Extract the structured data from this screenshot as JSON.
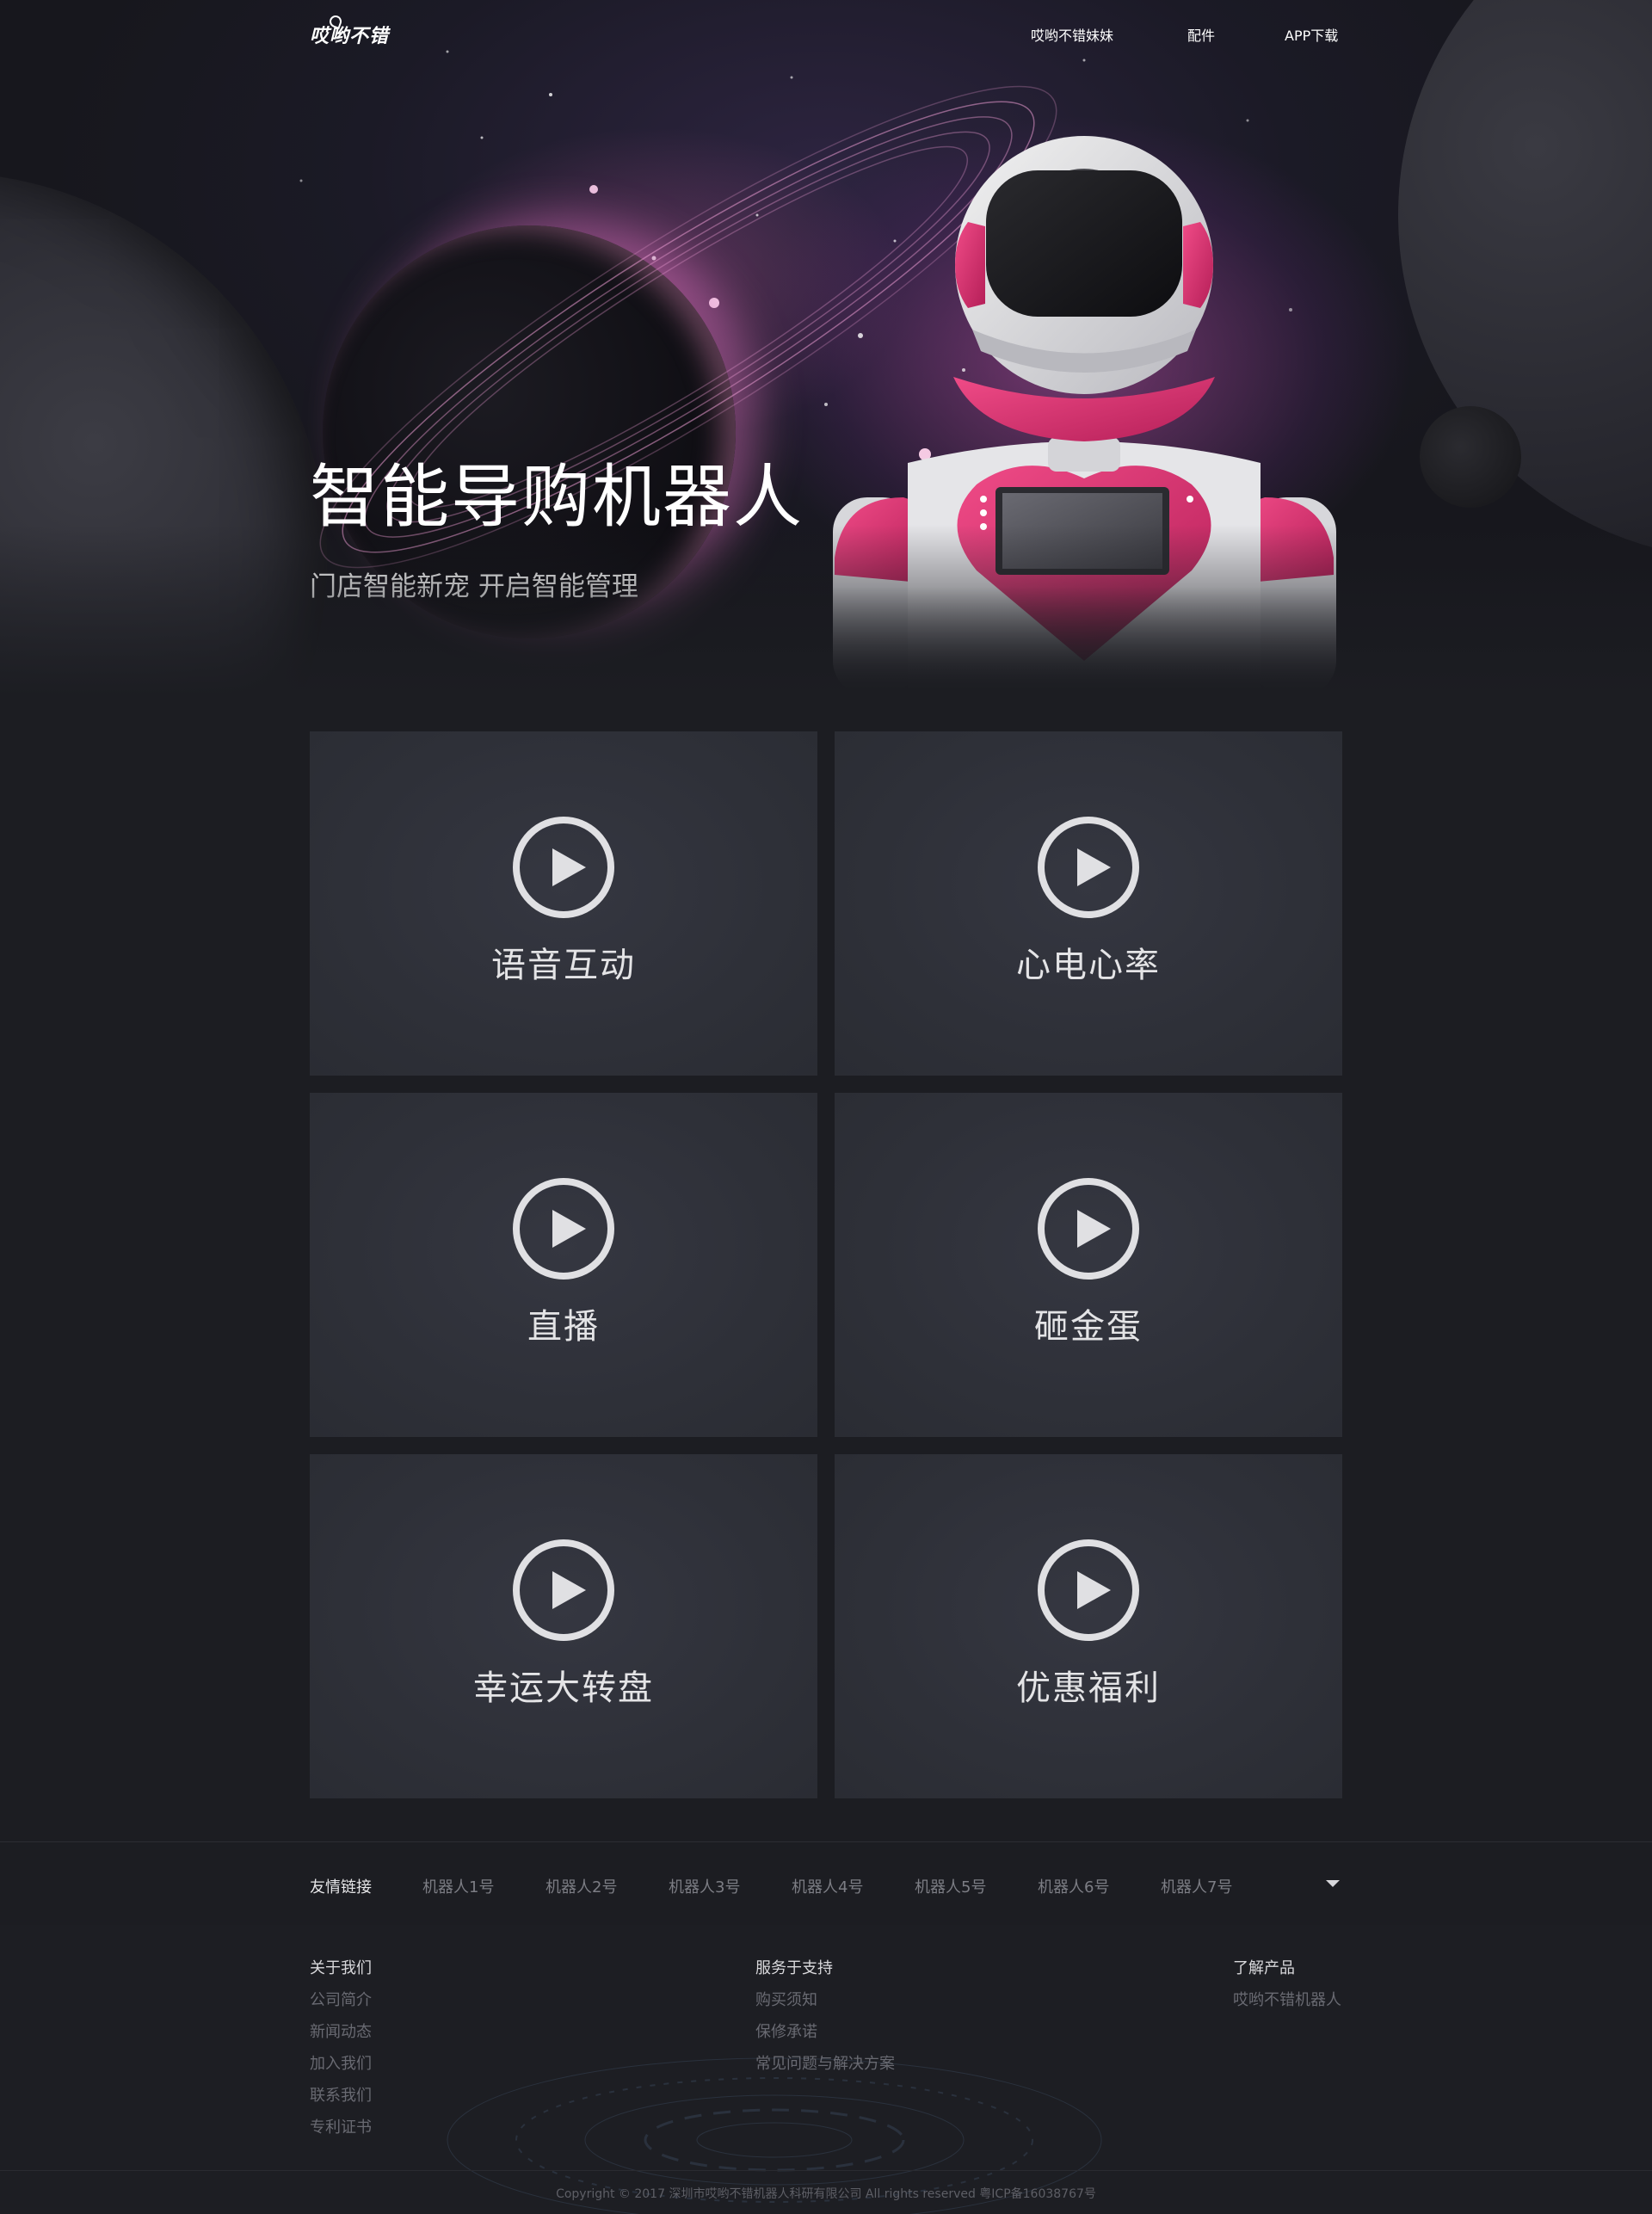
{
  "header": {
    "logo_text": "哎哟不错",
    "nav": [
      "哎哟不错妹妹",
      "配件",
      "APP下载"
    ]
  },
  "hero": {
    "title": "智能导购机器人",
    "subtitle": "门店智能新宠 开启智能管理"
  },
  "features": [
    {
      "label": "语音互动",
      "icon": "play-circle-icon"
    },
    {
      "label": "心电心率",
      "icon": "play-circle-icon"
    },
    {
      "label": "直播",
      "icon": "play-circle-icon"
    },
    {
      "label": "砸金蛋",
      "icon": "play-circle-icon"
    },
    {
      "label": "幸运大转盘",
      "icon": "play-circle-icon"
    },
    {
      "label": "优惠福利",
      "icon": "play-circle-icon"
    }
  ],
  "friend_links": {
    "label": "友情链接",
    "items": [
      "机器人1号",
      "机器人2号",
      "机器人3号",
      "机器人4号",
      "机器人5号",
      "机器人6号",
      "机器人7号"
    ],
    "toggle_icon": "caret-down-icon"
  },
  "footer": {
    "columns": [
      {
        "title": "关于我们",
        "links": [
          "公司简介",
          "新闻动态",
          "加入我们",
          "联系我们",
          "专利证书"
        ]
      },
      {
        "title": "服务于支持",
        "links": [
          "购买须知",
          "保修承诺",
          "常见问题与解决方案"
        ]
      },
      {
        "title": "了解产品",
        "links": [
          "哎哟不错机器人"
        ]
      }
    ],
    "copyright": "Copyright © 2017 深圳市哎哟不错机器人科研有限公司 All rights reserved 粤ICP备16038767号"
  },
  "colors": {
    "page_bg": "#1c1d22",
    "card_bg": "#2e3038",
    "robot_accent": "#d8366f",
    "text_muted": "#7c7d84"
  }
}
